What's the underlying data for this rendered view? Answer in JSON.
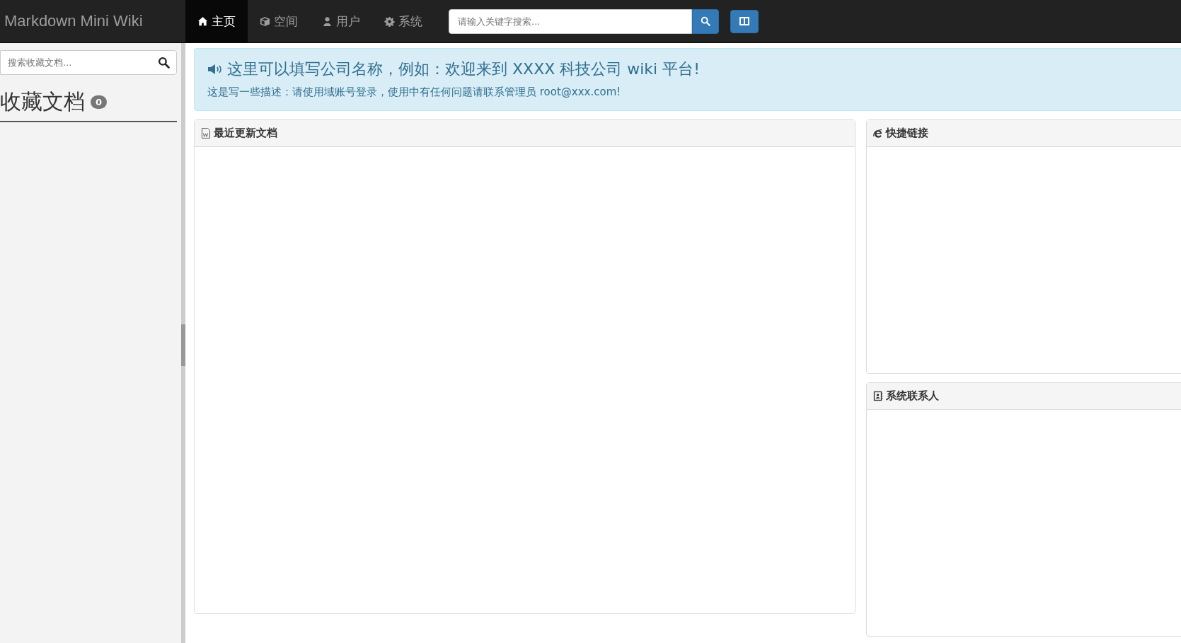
{
  "navbar": {
    "brand": "Markdown Mini Wiki",
    "items": [
      {
        "label": "主页",
        "kind": "home",
        "selected": true
      },
      {
        "label": "空间",
        "kind": "cube",
        "selected": false
      },
      {
        "label": "用户",
        "kind": "user",
        "selected": false
      },
      {
        "label": "系统",
        "kind": "gear",
        "selected": false
      }
    ],
    "search": {
      "placeholder": "请输入关键字搜索..."
    }
  },
  "sidebar": {
    "search": {
      "placeholder": "搜索收藏文档..."
    },
    "title": "收藏文档",
    "count": "0"
  },
  "alert": {
    "title": "这里可以填写公司名称，例如：欢迎来到 XXXX 科技公司 wiki 平台!",
    "description": "这是写一些描述：请使用域账号登录，使用中有任何问题请联系管理员 root@xxx.com!"
  },
  "panels": {
    "recent": {
      "title": "最近更新文档"
    },
    "links": {
      "title": "快捷链接"
    },
    "contacts": {
      "title": "系统联系人"
    }
  }
}
